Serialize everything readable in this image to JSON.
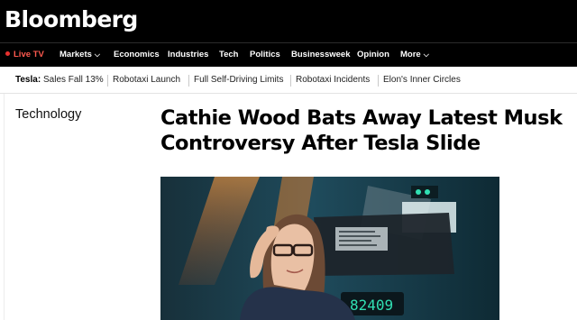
{
  "brand": {
    "logo_text": "Bloomberg"
  },
  "nav": {
    "live": "Live TV",
    "items": [
      "Markets",
      "Economics",
      "Industries",
      "Tech",
      "Politics",
      "Businessweek",
      "Opinion",
      "More"
    ],
    "chevron": "chevron-down-icon"
  },
  "topics": {
    "lead": "Tesla:",
    "items": [
      "Sales Fall 13%",
      "Robotaxi Launch",
      "Full Self-Driving Limits",
      "Robotaxi Incidents",
      "Elon's Inner Circles"
    ]
  },
  "article": {
    "category": "Technology",
    "headline_line1": "Cathie Wood Bats Away Latest Musk",
    "headline_line2": "Controversy After Tesla Slide",
    "image_alt": "Woman with long brown hair and dark-rimmed glasses raising her hand while speaking on stage",
    "screen_digits": "82409"
  },
  "colors": {
    "live_red": "#e8312f",
    "nav_bg": "#000000",
    "teal_led": "#31e0b3"
  }
}
